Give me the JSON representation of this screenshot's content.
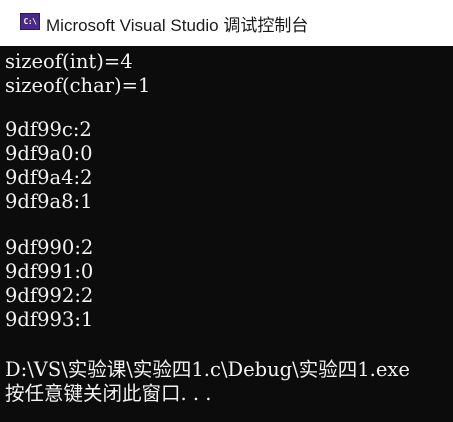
{
  "window": {
    "icon_text": "C:\\",
    "title": "Microsoft Visual Studio 调试控制台"
  },
  "console": {
    "lines": [
      "sizeof(int)=4",
      "sizeof(char)=1",
      "",
      "9df99c:2",
      "9df9a0:0",
      "9df9a4:2",
      "9df9a8:1",
      "",
      "9df990:2",
      "9df991:0",
      "9df992:2",
      "9df993:1",
      "",
      "D:\\VS\\实验课\\实验四1.c\\Debug\\实验四1.exe",
      "按任意键关闭此窗口. . ."
    ]
  },
  "colors": {
    "console_background": "#0c0c0c",
    "console_text": "#f2f2f2",
    "titlebar_background": "#ffffff",
    "icon_background": "#4b2a84"
  }
}
